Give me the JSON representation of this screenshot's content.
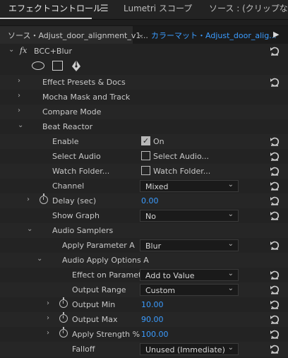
{
  "tabs": {
    "effect_controls": "エフェクトコントロール",
    "lumetri": "Lumetri スコープ",
    "source": "ソース : (クリップなし)"
  },
  "source_bar": {
    "source_clip": "ソース・Adjust_door_alignment_v1...",
    "sequence_clip": "カラーマット・Adjust_door_alig..."
  },
  "effect": {
    "fx_label": "fx",
    "name": "BCC+Blur"
  },
  "rows": {
    "effect_presets": "Effect Presets & Docs",
    "mocha": "Mocha Mask and Track",
    "compare_mode": "Compare Mode",
    "beat_reactor": "Beat Reactor",
    "enable_label": "Enable",
    "enable_value": "On",
    "select_audio_label": "Select Audio",
    "select_audio_value": "Select Audio...",
    "watch_folder_label": "Watch Folder...",
    "watch_folder_value": "Watch Folder...",
    "channel_label": "Channel",
    "channel_value": "Mixed",
    "delay_label": "Delay (sec)",
    "delay_value": "0.00",
    "show_graph_label": "Show Graph",
    "show_graph_value": "No",
    "audio_samplers": "Audio Samplers",
    "apply_param_a_label": "Apply Parameter A",
    "apply_param_a_value": "Blur",
    "audio_apply_options": "Audio Apply Options A",
    "effect_on_param_label": "Effect on Parameter",
    "effect_on_param_value": "Add to Value",
    "output_range_label": "Output Range",
    "output_range_value": "Custom",
    "output_min_label": "Output Min",
    "output_min_value": "10.00",
    "output_max_label": "Output Max",
    "output_max_value": "90.00",
    "apply_strength_label": "Apply Strength %",
    "apply_strength_value": "100.00",
    "falloff_label": "Falloff",
    "falloff_value": "Unused (Immediate)"
  },
  "colors": {
    "accent_blue": "#3b9cff",
    "panel_bg": "#232323"
  }
}
